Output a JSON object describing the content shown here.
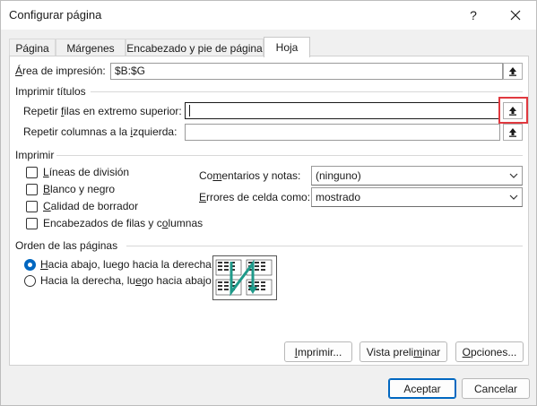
{
  "window": {
    "title": "Configurar página",
    "help_label": "?",
    "close_label": "✕"
  },
  "tabs": [
    {
      "label": "Página",
      "active": false
    },
    {
      "label": "Márgenes",
      "active": false
    },
    {
      "label": "Encabezado y pie de página",
      "active": false
    },
    {
      "label": "Hoja",
      "active": true
    }
  ],
  "print_area": {
    "label_first": "Á",
    "label_rest": "rea de impresión:",
    "value": "$B:$G"
  },
  "print_titles": {
    "heading": "Imprimir títulos",
    "rows_label_pre": "Repetir ",
    "rows_label_u": "f",
    "rows_label_post": "ilas en extremo superior:",
    "rows_value": "",
    "cols_label_pre": "Repetir columnas a la ",
    "cols_label_u": "i",
    "cols_label_post": "zquierda:",
    "cols_value": ""
  },
  "print": {
    "heading": "Imprimir",
    "checkboxes": [
      {
        "u": "L",
        "rest": "íneas de división",
        "checked": false
      },
      {
        "u": "B",
        "rest": "lanco y negro",
        "checked": false
      },
      {
        "u": "C",
        "rest": "alidad de borrador",
        "checked": false
      },
      {
        "pre": "Encabezados de filas y c",
        "u": "o",
        "rest": "lumnas",
        "checked": false
      }
    ],
    "comments_label_pre": "Co",
    "comments_label_u": "m",
    "comments_label_post": "entarios y notas:",
    "comments_value": "(ninguno)",
    "errors_label_u": "E",
    "errors_label_post": "rrores de celda como:",
    "errors_value": "mostrado"
  },
  "page_order": {
    "heading": "Orden de las páginas",
    "option_down_pre": "",
    "option_down_u": "H",
    "option_down_post": "acia abajo, luego hacia la derecha",
    "option_down_selected": true,
    "option_over_pre": "Hacia la derecha, lu",
    "option_over_u": "e",
    "option_over_post": "go hacia abajo",
    "option_over_selected": false
  },
  "buttons": {
    "print_u": "I",
    "print_rest": "mprimir...",
    "preview_pre": "Vista preli",
    "preview_u": "m",
    "preview_post": "inar",
    "options_u": "O",
    "options_rest": "pciones...",
    "accept": "Aceptar",
    "cancel": "Cancelar"
  },
  "colors": {
    "accent": "#0067c0",
    "highlight": "#e0393f",
    "page_order_arrow": "#1f9a8a"
  }
}
